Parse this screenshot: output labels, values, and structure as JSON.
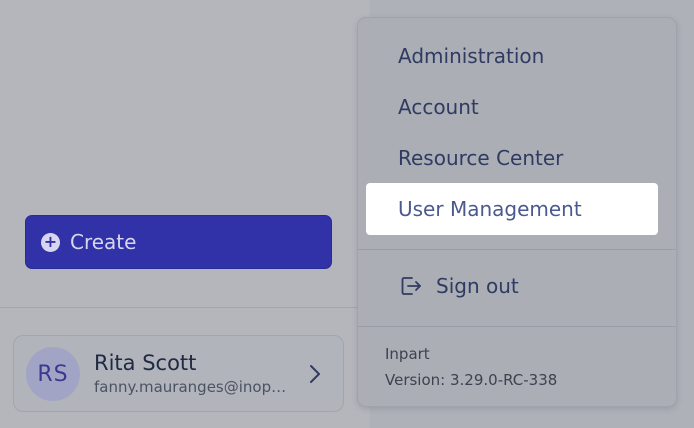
{
  "sidebar": {
    "create_label": "Create",
    "user": {
      "initials": "RS",
      "name": "Rita Scott",
      "email": "fanny.mauranges@inopart.com"
    }
  },
  "menu": {
    "items": [
      {
        "label": "Administration"
      },
      {
        "label": "Account"
      },
      {
        "label": "Resource Center"
      },
      {
        "label": "User Management",
        "highlighted": true
      }
    ],
    "signout_label": "Sign out",
    "app_name": "Inpart",
    "version": "Version: 3.29.0-RC-338"
  },
  "colors": {
    "accent": "#3232a8",
    "menu_text": "#2f3b62",
    "highlight_bg": "#ffffff"
  }
}
